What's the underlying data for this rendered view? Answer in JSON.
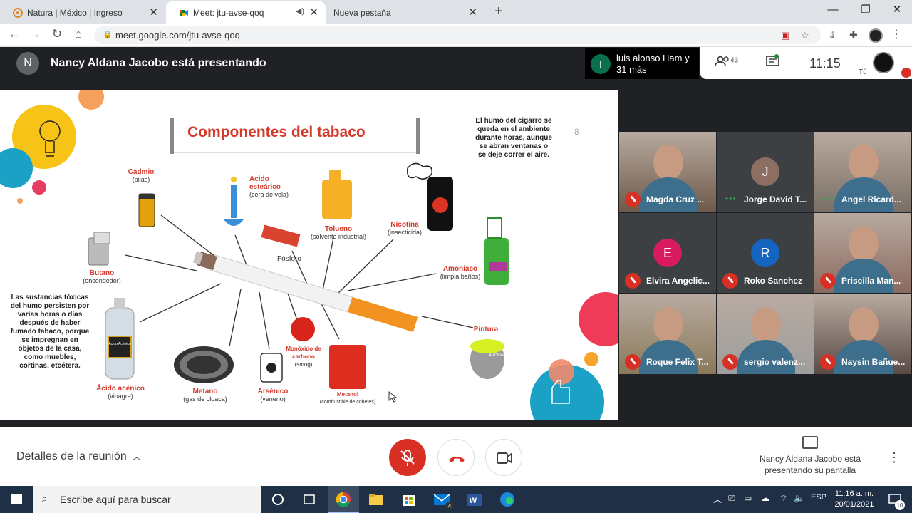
{
  "browser": {
    "tabs": [
      {
        "title": "Natura | México | Ingreso"
      },
      {
        "title": "Meet: jtu-avse-qoq"
      },
      {
        "title": "Nueva pestaña"
      }
    ],
    "url": "meet.google.com/jtu-avse-qoq"
  },
  "meet": {
    "presenter_initial": "N",
    "presenter_banner": "Nancy Aldana Jacobo está presentando",
    "others_initial": "I",
    "others_text": "luis alonso Ham y 31 más",
    "participant_count": "43",
    "time": "11:15",
    "self_label": "Tú",
    "meeting_details": "Detalles de la reunión",
    "presenting_notice": "Nancy Aldana Jacobo está presentando su pantalla"
  },
  "slide": {
    "title": "Componentes del tabaco",
    "page_number": "8",
    "note_right": "El humo del cigarro se queda en el ambiente durante horas, aunque se abran ventanas o se deje correr el aire.",
    "note_left": "Las sustancias tóxicas del humo persisten por varias horas o días después de haber fumado tabaco, porque se impregnan en objetos de la casa, como muebles, cortinas, etcétera.",
    "labels": [
      {
        "name": "Cadmio",
        "desc": "(pilas)"
      },
      {
        "name": "Ácido esteárico",
        "desc": "(cera de vela)"
      },
      {
        "name": "Tolueno",
        "desc": "(solvente industrial)"
      },
      {
        "name": "Nicotina",
        "desc": "(insecticida)"
      },
      {
        "name": "Amoniaco",
        "desc": "(limpia baños)"
      },
      {
        "name": "Butano",
        "desc": "(encendedor)"
      },
      {
        "name": "Fósforo",
        "desc": ""
      },
      {
        "name": "Pintura",
        "desc": ""
      },
      {
        "name": "Monóxido de carbono",
        "desc": "(smog)"
      },
      {
        "name": "Ácido acénico",
        "desc": "(vinagre)"
      },
      {
        "name": "Metano",
        "desc": "(gas de cloaca)"
      },
      {
        "name": "Arsénico",
        "desc": "(veneno)"
      },
      {
        "name": "Metanol",
        "desc": "(combustible de cohetes)"
      }
    ],
    "bottle_label": "Ácido Acénico",
    "ammonia_label": "AMONIACO"
  },
  "participants": [
    {
      "name": "Magda Cruz ...",
      "initial": "",
      "color": "#6d5a4a",
      "muted": true
    },
    {
      "name": "Jorge David T...",
      "initial": "J",
      "color": "#8d6e63",
      "muted": false
    },
    {
      "name": "Angel Ricard...",
      "initial": "",
      "color": "#7a6f66",
      "muted": false
    },
    {
      "name": "Elvira Angelic...",
      "initial": "E",
      "color": "#d81b60",
      "muted": true
    },
    {
      "name": "Roko Sanchez",
      "initial": "R",
      "color": "#1565c0",
      "muted": true
    },
    {
      "name": "Priscilla Man...",
      "initial": "",
      "color": "#8a6a60",
      "muted": true
    },
    {
      "name": "Roque Felix T...",
      "initial": "",
      "color": "#8a7a5a",
      "muted": true
    },
    {
      "name": "sergio valenz...",
      "initial": "",
      "color": "#9e9e9e",
      "muted": true
    },
    {
      "name": "Naysin Bañue...",
      "initial": "",
      "color": "#5a4a45",
      "muted": true
    }
  ],
  "taskbar": {
    "search_placeholder": "Escribe aquí para buscar",
    "lang": "ESP",
    "time": "11:16 a. m.",
    "date": "20/01/2021",
    "mail_badge": "4",
    "notif_count": "10"
  },
  "colors": {
    "meet_red": "#d93025",
    "slide_red": "#d33a2c",
    "dark": "#202124"
  }
}
